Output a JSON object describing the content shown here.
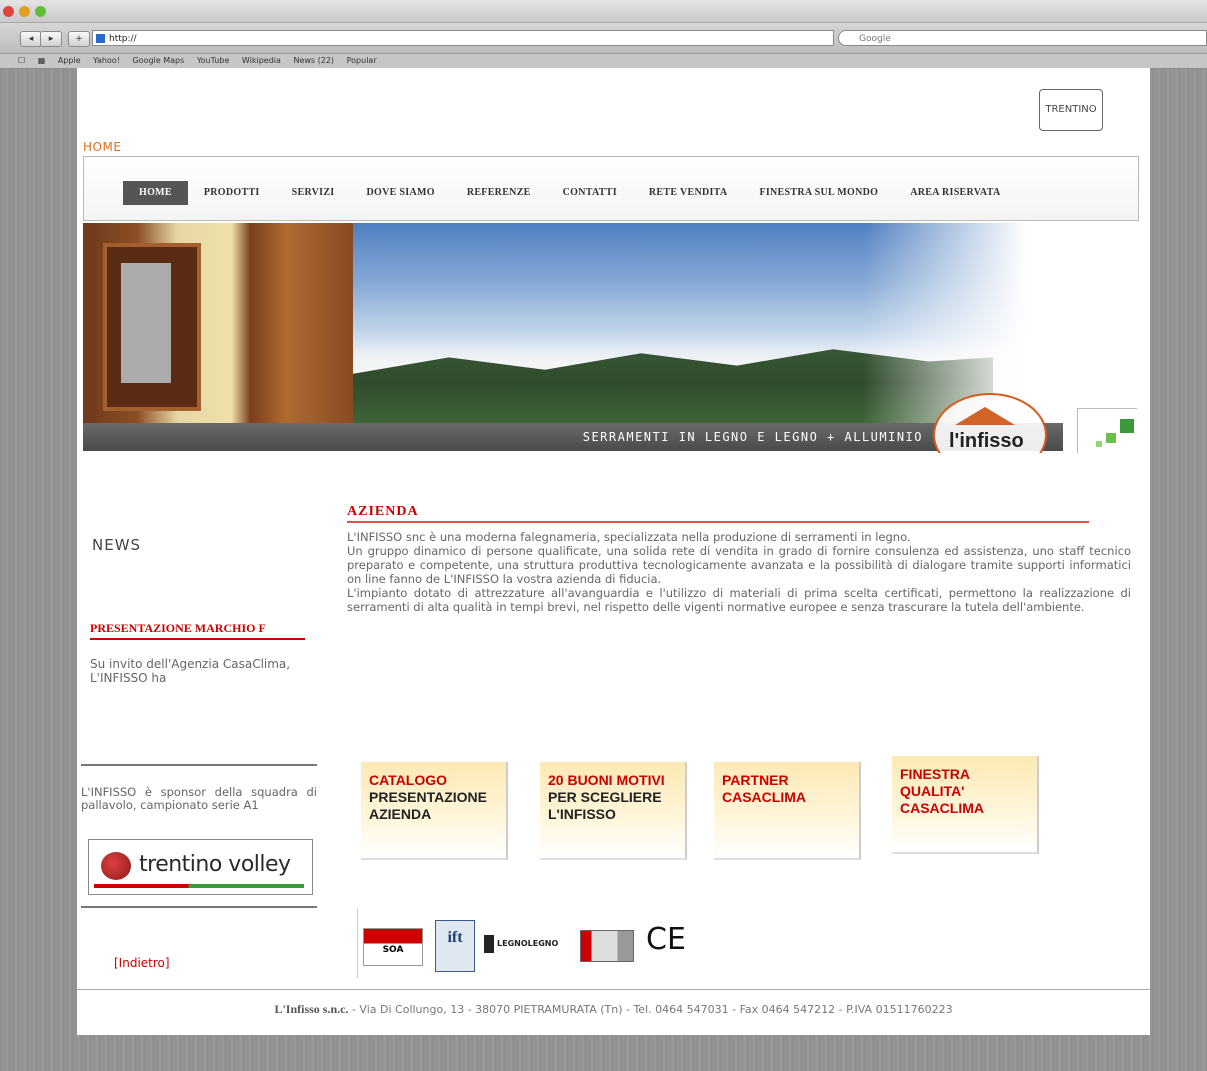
{
  "browser": {
    "url": "http://",
    "search_placeholder": "Google",
    "bookmarks": [
      "Apple",
      "Yahoo!",
      "Google Maps",
      "YouTube",
      "Wikipedia",
      "News (22)",
      "Popular"
    ]
  },
  "header": {
    "logo_text": "TRENTINO",
    "breadcrumb": "HOME"
  },
  "menu": {
    "items": [
      {
        "label": "HOME",
        "active": true
      },
      {
        "label": "PRODOTTI"
      },
      {
        "label": "SERVIZI"
      },
      {
        "label": "DOVE SIAMO"
      },
      {
        "label": "REFERENZE"
      },
      {
        "label": "CONTATTI"
      },
      {
        "label": "RETE VENDITA"
      },
      {
        "label": "FINESTRA SUL MONDO"
      },
      {
        "label": "AREA RISERVATA"
      }
    ]
  },
  "banner": {
    "tagline": "SERRAMENTI IN LEGNO E LEGNO + ALLUMINIO",
    "logo_text": "l'infisso"
  },
  "news": {
    "heading": "NEWS",
    "title": "PRESENTAZIONE MARCHIO F",
    "body": "Su invito dell'Agenzia CasaClima, L'INFISSO ha"
  },
  "sponsor": {
    "text": "L'INFISSO è sponsor della squadra di pallavolo, campionato serie A1",
    "logo_text": "trentino volley"
  },
  "back_link": "[Indietro]",
  "azienda": {
    "title": "AZIENDA",
    "paragraphs": [
      "L'INFISSO snc è una moderna falegnameria, specializzata nella produzione di serramenti in legno.",
      "Un gruppo dinamico di persone qualificate, una solida rete di vendita in grado di fornire consulenza ed assistenza, uno staff tecnico preparato e competente, una struttura produttiva tecnologicamente avanzata e la possibilità di dialogare tramite supporti informatici on line fanno de L'INFISSO la vostra azienda di fiducia.",
      "L'impianto dotato di attrezzature all'avanguardia e l'utilizzo di materiali di prima scelta certificati, permettono la realizzazione di serramenti di alta qualità in tempi brevi, nel rispetto delle vigenti normative europee e senza trascurare la tutela dell'ambiente."
    ]
  },
  "tiles": [
    {
      "line1": "CATALOGO",
      "line2": "PRESENTAZIONE AZIENDA"
    },
    {
      "line1": "20 BUONI MOTIVI",
      "line2": "PER SCEGLIERE L'INFISSO"
    },
    {
      "line1": "PARTNER",
      "line2": "CASACLIMA"
    },
    {
      "line1": "FINESTRA",
      "line2": "QUALITA' CASACLIMA"
    }
  ],
  "certs": {
    "soa": "SOA",
    "ift": "ift",
    "legno": "LEGNOLEGNO",
    "ce": "CE"
  },
  "footer": {
    "company": "L'Infisso s.n.c.",
    "details": " - Via Di Collungo, 13 - 38070 PIETRAMURATA (Tn) - Tel. 0464 547031 - Fax 0464 547212 - P.IVA 01511760223"
  }
}
